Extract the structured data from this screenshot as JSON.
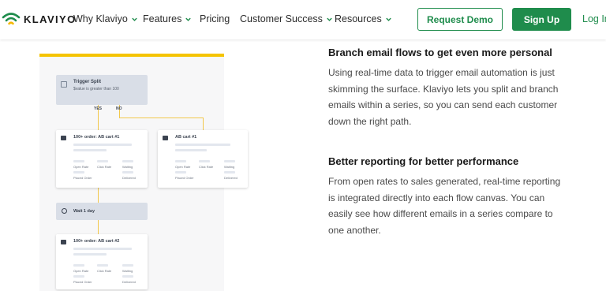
{
  "nav": {
    "brand": "KLAVIYO",
    "items": [
      {
        "label": "Why Klaviyo",
        "dropdown": true
      },
      {
        "label": "Features",
        "dropdown": true
      },
      {
        "label": "Pricing",
        "dropdown": false
      },
      {
        "label": "Customer Success",
        "dropdown": true
      },
      {
        "label": "Resources",
        "dropdown": true
      }
    ],
    "request_demo": "Request Demo",
    "sign_up": "Sign Up",
    "login": "Log In"
  },
  "diagram": {
    "trigger_title": "Trigger Split",
    "trigger_sub": "$value is greater than 100",
    "yes": "YES",
    "no": "NO",
    "card1_title": "100+ order: AB cart #1",
    "card2_title": "AB cart #1",
    "card3_title": "100+ order: AB cart #2",
    "wait": "Wait 1 day",
    "metrics": {
      "open": "Open Rate",
      "click": "Click Rate",
      "waiting": "Waiting",
      "placed": "Placed Order",
      "delivered": "Delivered"
    }
  },
  "section1": {
    "title": "Branch email flows to get even more personal",
    "body": "Using real-time data to trigger email automation is just skimming the surface. Klaviyo lets you split and branch emails within a series, so you can send each customer down the right path."
  },
  "section2": {
    "title": "Better reporting for better performance",
    "body": "From open rates to sales generated, real-time reporting is integrated directly into each flow canvas. You can easily see how different emails in a series compare to one another."
  },
  "colors": {
    "brand_green": "#1f8c4c",
    "accent_yellow": "#f5c400"
  }
}
